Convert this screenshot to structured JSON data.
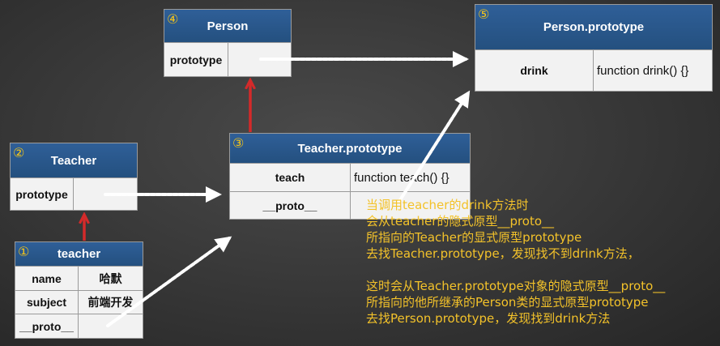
{
  "person": {
    "num": "④",
    "title": "Person",
    "rows": [
      {
        "key": "prototype",
        "value": ""
      }
    ]
  },
  "person_prototype": {
    "num": "⑤",
    "title": "Person.prototype",
    "rows": [
      {
        "key": "drink",
        "value": "function drink() {}"
      }
    ]
  },
  "teacher_class": {
    "num": "②",
    "title": "Teacher",
    "rows": [
      {
        "key": "prototype",
        "value": ""
      }
    ]
  },
  "teacher_prototype": {
    "num": "③",
    "title": "Teacher.prototype",
    "rows": [
      {
        "key": "teach",
        "value": "function teach() {}"
      },
      {
        "key": "__proto__",
        "value": ""
      }
    ]
  },
  "teacher_instance": {
    "num": "①",
    "title": "teacher",
    "rows": [
      {
        "key": "name",
        "value": "哈默"
      },
      {
        "key": "subject",
        "value": "前端开发"
      },
      {
        "key": "__proto__",
        "value": ""
      }
    ]
  },
  "explanation": {
    "lines1": [
      "当调用teacher的drink方法时",
      "会从teacher的隐式原型__proto__",
      "所指向的Teacher的显式原型prototype",
      "去找Teacher.prototype，发现找不到drink方法，"
    ],
    "lines2": [
      "这时会从Teacher.prototype对象的隐式原型__proto__",
      "所指向的他所继承的Person类的显式原型prototype",
      "去找Person.prototype，发现找到drink方法"
    ]
  },
  "colors": {
    "header_blue": "#2a5a92",
    "highlight_yellow": "#f3c22a",
    "inherit_arrow_red": "#d42a2a",
    "pointer_arrow_white": "#ffffff"
  }
}
